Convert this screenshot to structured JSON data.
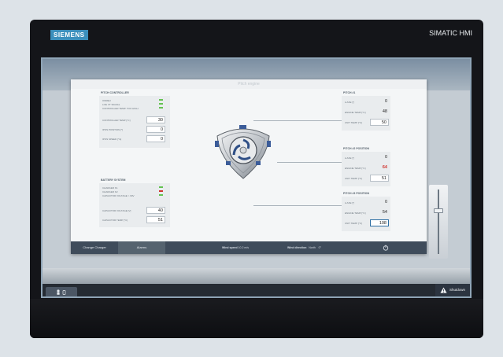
{
  "device": {
    "brand": "SIEMENS",
    "product": "SIMATIC HMI"
  },
  "window": {
    "title": "Pitch engine"
  },
  "pitch_controller": {
    "title": "PITCH CONTROLLER",
    "status_rows": [
      {
        "label": "ONREU",
        "led": "#63c250"
      },
      {
        "label": "LOE VT SIGNAL",
        "led": "#63c250"
      },
      {
        "label": "CONTROLLER TEMP. TOO HIGH",
        "led": "#63c250"
      }
    ],
    "value_rows": [
      {
        "label": "CONTROLLER TEMP [°C]",
        "value": "30"
      },
      {
        "label": "IPOS POSITION [°]",
        "value": "0"
      },
      {
        "label": "IPOS SPEED [°/s]",
        "value": "0"
      }
    ]
  },
  "battery_system": {
    "title": "BATTERY SYSTEM",
    "status_rows": [
      {
        "label": "CHARGER K1",
        "led": "#63c250"
      },
      {
        "label": "CHARGER K2",
        "led": "#d0332e"
      },
      {
        "label": "CAPACITOR VOLTAGE > 60V",
        "led": "#63c250"
      }
    ],
    "value_rows": [
      {
        "label": "CAPACITOR VOLTAGE [V]",
        "value": "40"
      },
      {
        "label": "CAPACITOR TEMP [°C]",
        "value": "51"
      }
    ]
  },
  "pitch_1": {
    "title": "PITCH #1",
    "rows": [
      {
        "label": "A AXE [°]",
        "value": "0"
      },
      {
        "label": "ENGINE TEMP [°C]",
        "value": "48"
      },
      {
        "label": "UNIT TEMP [°C]",
        "value": "50"
      }
    ]
  },
  "pitch_2": {
    "title": "PITCH #2 POSITION",
    "rows": [
      {
        "label": "A AXE [°]",
        "value": "0"
      },
      {
        "label": "ENGINE TEMP [°C]",
        "value": "64"
      },
      {
        "label": "UNIT TEMP [°C]",
        "value": "51"
      }
    ]
  },
  "pitch_3": {
    "title": "PITCH #3 POSITION",
    "rows": [
      {
        "label": "A AXE [°]",
        "value": "0"
      },
      {
        "label": "ENGINE TEMP [°C]",
        "value": "54"
      },
      {
        "label": "UNIT TEMP [°C]",
        "value": "108"
      }
    ]
  },
  "footer": {
    "change_charger": "Change Charger",
    "alarms": "Alarms",
    "wind_speed_label": "Wind speed",
    "wind_speed_value": "10.2 m/s",
    "wind_direction_label": "Wind direction",
    "wind_direction_value": "North",
    "wind_direction_deg": "0°"
  },
  "screen_bottom": {
    "shutdown": "Shutdown"
  },
  "colors": {
    "accent": "#2d6ea3",
    "alarm": "#d0332e",
    "ok": "#63c250"
  },
  "icons": [
    "warning-icon",
    "power-icon",
    "shield-icon",
    "wind-turbine-hub-icon"
  ]
}
